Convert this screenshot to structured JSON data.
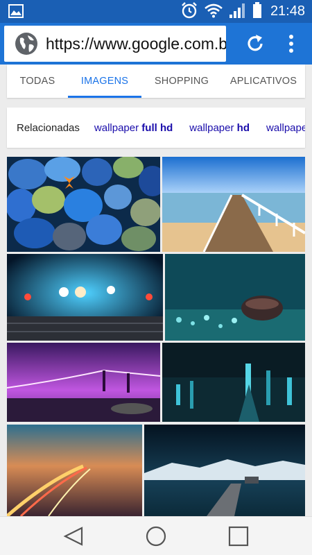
{
  "status_bar": {
    "time": "21:48",
    "colors": {
      "bg": "#1a5fb4"
    }
  },
  "browser": {
    "url": "https://www.google.com.br",
    "colors": {
      "bg": "#1e74d6"
    }
  },
  "tabs": [
    {
      "label": "TODAS"
    },
    {
      "label": "IMAGENS"
    },
    {
      "label": "SHOPPING"
    },
    {
      "label": "APLICATIVOS"
    }
  ],
  "related": {
    "label": "Relacionadas",
    "chips": [
      {
        "prefix": "wallpaper ",
        "bold": "full hd"
      },
      {
        "prefix": "wallpaper ",
        "bold": "hd"
      },
      {
        "prefix": "wallpaper",
        "bold": ""
      }
    ]
  },
  "images": [
    "blue-pebbles-butterfly",
    "pier-ocean",
    "bokeh-wood-table",
    "coffee-bean-bokeh",
    "purple-bridge-night",
    "city-night-aerial",
    "highway-light-trails",
    "lake-mountains-night-pier"
  ],
  "icons": [
    "picture-icon",
    "alarm-icon",
    "wifi-icon",
    "signal-icon",
    "battery-icon",
    "globe-icon",
    "reload-icon",
    "menu-icon",
    "back-icon",
    "home-icon",
    "recents-icon"
  ]
}
